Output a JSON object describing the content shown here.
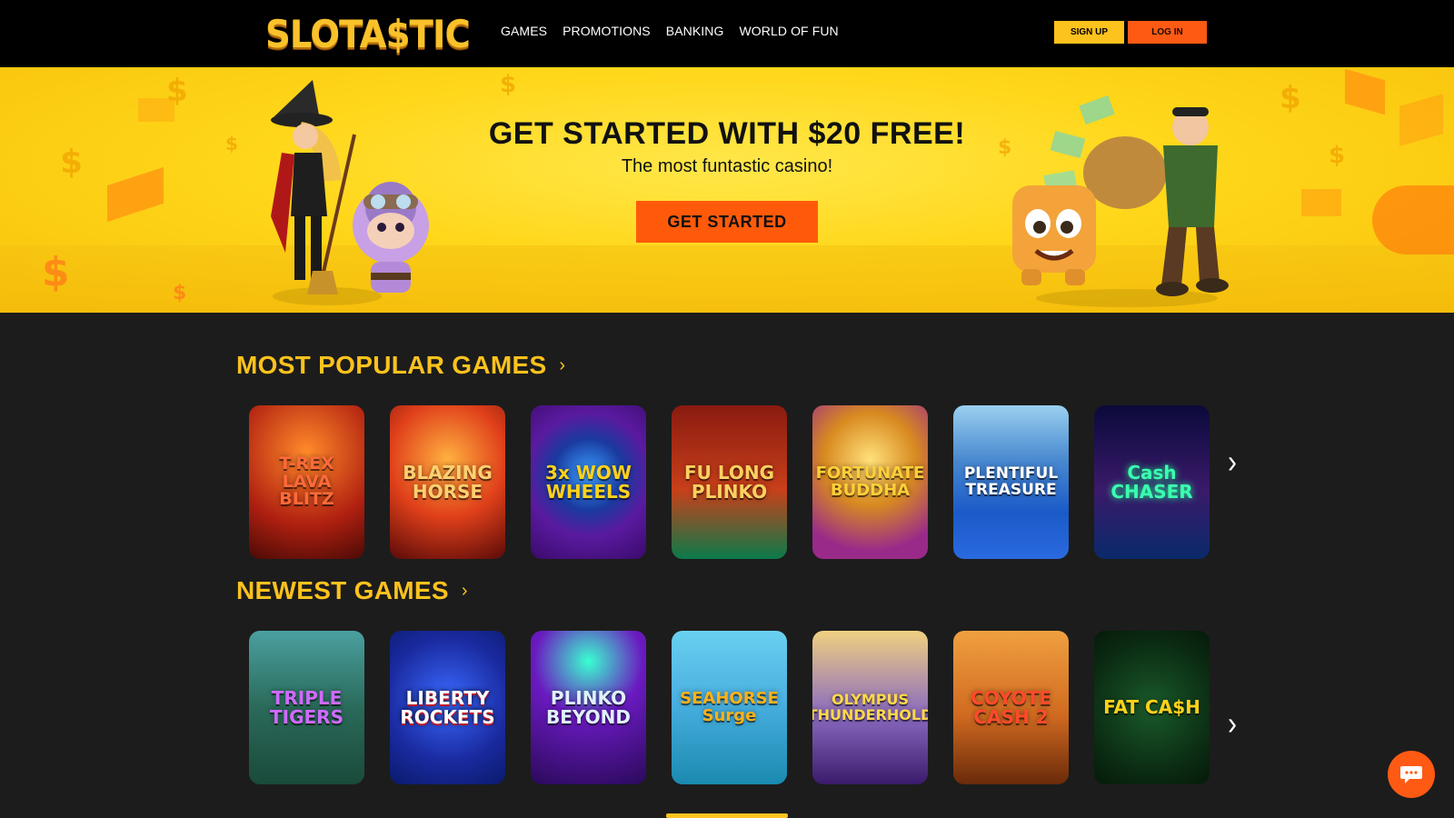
{
  "header": {
    "logo": "SLOTA$TIC",
    "nav": [
      "GAMES",
      "PROMOTIONS",
      "BANKING",
      "WORLD OF FUN"
    ],
    "signup_label": "SIGN UP",
    "login_label": "LOG IN"
  },
  "hero": {
    "title": "GET STARTED WITH $20 FREE!",
    "subtitle": "The most funtastic casino!",
    "cta_label": "GET STARTED"
  },
  "sections": {
    "popular": {
      "title": "MOST POPULAR GAMES",
      "games": [
        "T-REX LAVA BLITZ",
        "BLAZING HORSE",
        "3x WOW WHEELS",
        "FU LONG PLINKO",
        "FORTUNATE BUDDHA",
        "PLENTIFUL TREASURE",
        "Cash CHASER"
      ]
    },
    "newest": {
      "title": "NEWEST GAMES",
      "games": [
        "TRIPLE TIGERS",
        "LIBERTY ROCKETS",
        "PLINKO BEYOND",
        "SEAHORSE Surge",
        "OLYMPUS THUNDERHOLD",
        "COYOTE CASH 2",
        "FAT CA$H"
      ]
    }
  },
  "colors": {
    "brand_yellow": "#fcc21d",
    "brand_orange": "#ff5a14",
    "background": "#1c1c1c",
    "header_bg": "#000000"
  },
  "icons": {
    "row_next": "chevron-right-icon",
    "section_more": "chevron-right-icon",
    "chat": "chat-bubble-icon"
  }
}
